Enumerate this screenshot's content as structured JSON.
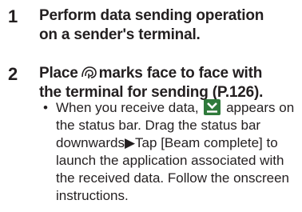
{
  "steps": [
    {
      "number": "1",
      "lines": [
        "Perform data sending operation",
        "on a sender's terminal."
      ]
    },
    {
      "number": "2",
      "line1_before": "Place",
      "line1_after": "marks face to face with",
      "line2": "the terminal for sending (P.126)."
    }
  ],
  "note": {
    "bullet": "•",
    "text_before_icon": "When you receive data,",
    "text_after_icon": "appears on the status bar. Drag the status bar downwards▶Tap [Beam complete] to launch the application associated with the received data. Follow the onscreen instructions."
  },
  "icons": {
    "nfc_mark": "nfc-mark-icon",
    "beam_download": "beam-download-icon",
    "beam_icon_color": "#2f7a3b"
  }
}
